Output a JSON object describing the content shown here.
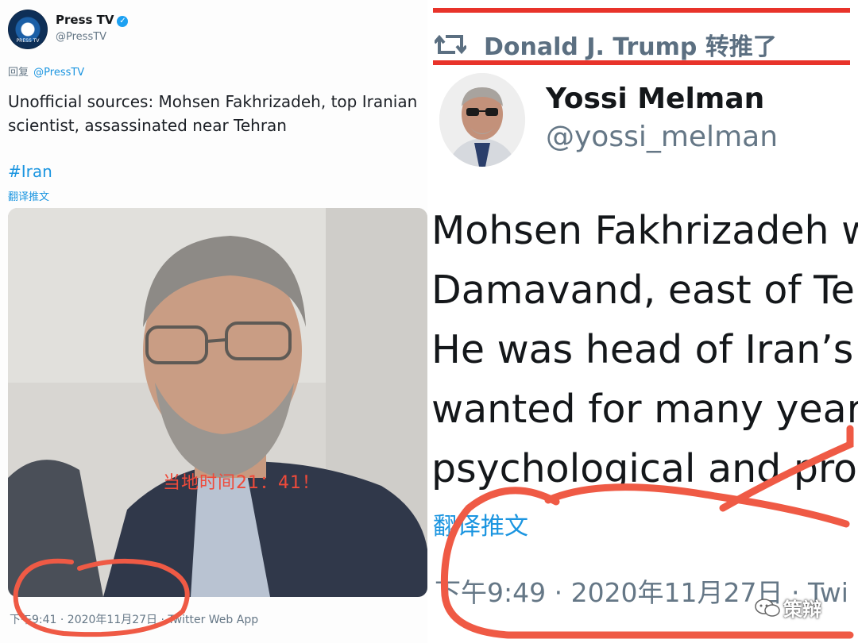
{
  "left_tweet": {
    "author_name": "Press TV",
    "author_handle": "@PressTV",
    "avatar_label": "PRESS TV",
    "reply_prefix": "回复",
    "reply_mention": "@PressTV",
    "text_line1": "Unofficial sources: Mohsen Fakhrizadeh, top Iranian",
    "text_line2": "scientist, assassinated near Tehran",
    "hashtag": "#Iran",
    "translate_label": "翻译推文",
    "photo_overlay_text": "当地时间21：41！",
    "timestamp": "下午9:41 · 2020年11月27日 · ",
    "app": "Twitter Web App"
  },
  "right_tweet": {
    "retweet_label": "Donald J. Trump 转推了",
    "author_name": "Yossi Melman",
    "author_handle": "@yossi_melman",
    "text_lines": [
      "Mohsen Fakhrizadeh was",
      "Damavand, east of Tehran",
      "He was head of Iran’s",
      "wanted for many years",
      "psychological and pro"
    ],
    "translate_label": "翻译推文",
    "timestamp": "下午9:49 · 2020年11月27日 · Twi"
  },
  "watermark": {
    "label": "策辩"
  },
  "colors": {
    "annotation_red": "#e8332a",
    "twitter_blue": "#1b95e0",
    "muted_grey": "#657786"
  }
}
